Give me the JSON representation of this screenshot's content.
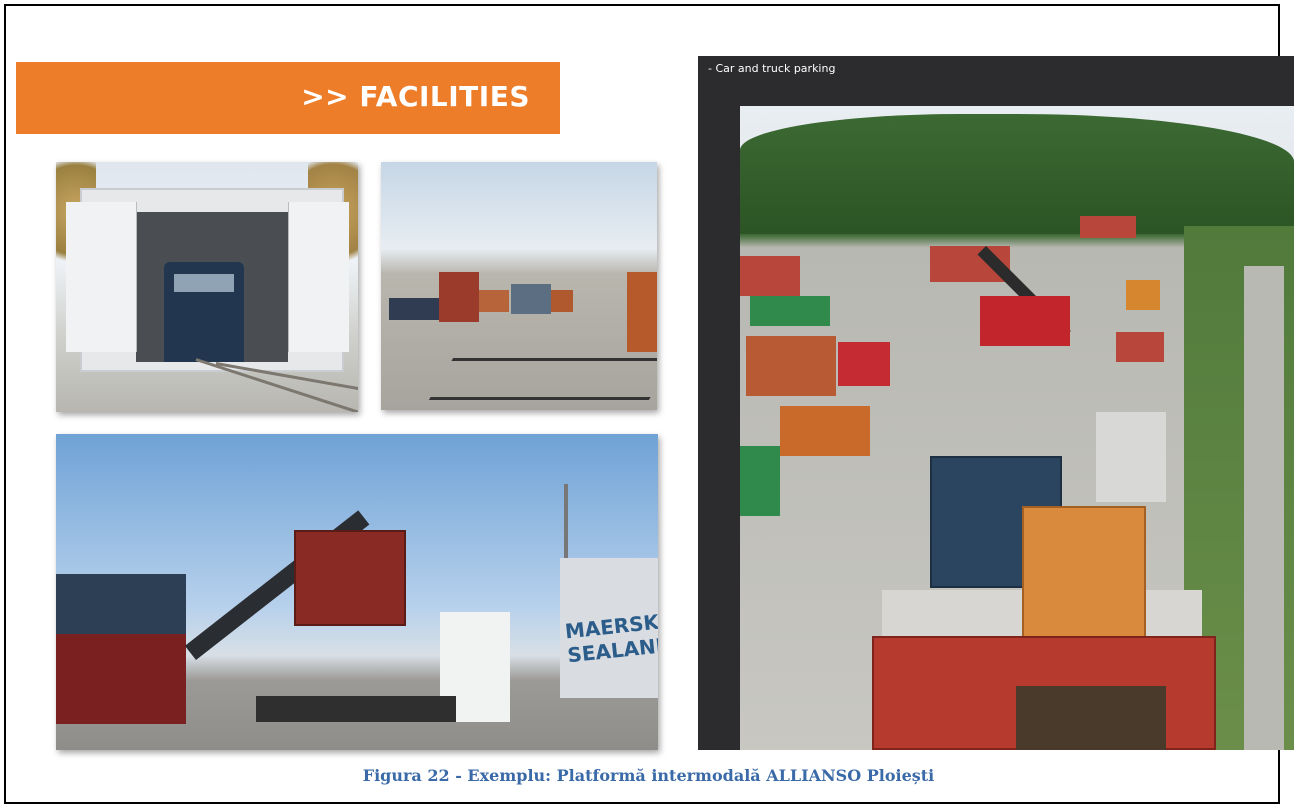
{
  "left_page": {
    "banner_title": ">> FACILITIES"
  },
  "right_page": {
    "caption": "-  Car and truck parking"
  },
  "photos": {
    "maersk_text": "MAERSK SEALAND"
  },
  "figure": {
    "caption": "Figura 22 - Exemplu: Platformă intermodală ALLIANSO Ploiești"
  },
  "colors": {
    "banner_orange": "#ee7d2a",
    "caption_blue": "#3a6aa8",
    "right_page_bg": "#2c2c2f"
  }
}
